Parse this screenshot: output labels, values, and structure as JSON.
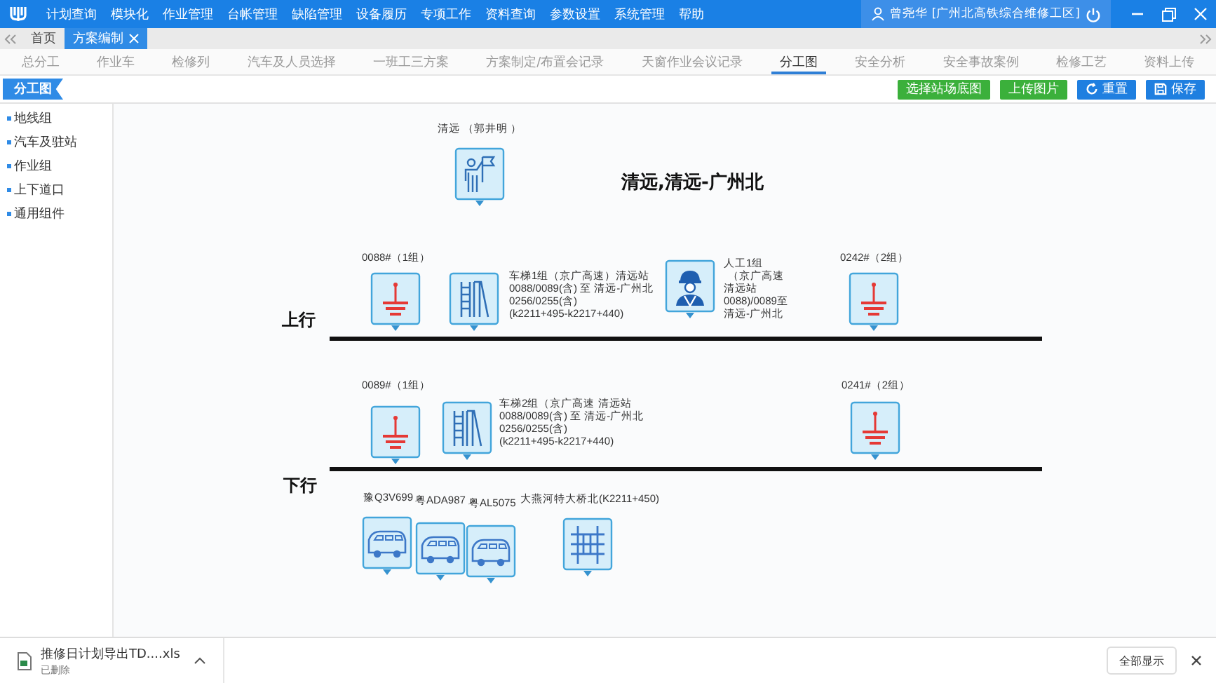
{
  "menu": [
    "计划查询",
    "模块化",
    "作业管理",
    "台帐管理",
    "缺陷管理",
    "设备履历",
    "专项工作",
    "资料查询",
    "参数设置",
    "系统管理",
    "帮助"
  ],
  "user": "曾尧华 [广州北高铁综合维修工区]",
  "window_tabs": [
    {
      "label": "首页",
      "selected": false,
      "closable": false
    },
    {
      "label": "方案编制",
      "selected": true,
      "closable": true
    }
  ],
  "sub_tabs": [
    {
      "label": "总分工",
      "selected": false
    },
    {
      "label": "作业车",
      "selected": false
    },
    {
      "label": "检修列",
      "selected": false
    },
    {
      "label": "汽车及人员选择",
      "selected": false
    },
    {
      "label": "一班工三方案",
      "selected": false
    },
    {
      "label": "方案制定/布置会记录",
      "selected": false
    },
    {
      "label": "天窗作业会议记录",
      "selected": false
    },
    {
      "label": "分工图",
      "selected": true
    },
    {
      "label": "安全分析",
      "selected": false
    },
    {
      "label": "安全事故案例",
      "selected": false
    },
    {
      "label": "检修工艺",
      "selected": false
    },
    {
      "label": "资料上传",
      "selected": false
    }
  ],
  "sidebar": {
    "title": "分工图",
    "items": [
      "地线组",
      "汽车及驻站",
      "作业组",
      "上下道口",
      "通用组件"
    ]
  },
  "toolbar": [
    {
      "label": "选择站场底图",
      "kind": "green"
    },
    {
      "label": "上传图片",
      "kind": "green"
    },
    {
      "label": "重置",
      "kind": "reset"
    },
    {
      "label": "保存",
      "kind": "save"
    }
  ],
  "canvas": {
    "title": "清远,清远-广州北",
    "tracks": [
      {
        "label": "上行"
      },
      {
        "label": "下行"
      }
    ],
    "items": [
      {
        "kind": "flag",
        "label": "清远 （郭井明 ）"
      },
      {
        "kind": "ground",
        "label": "0088#（1组）"
      },
      {
        "kind": "ladder",
        "label": "车梯1组（京广高速）清远站\n0088/0089(含) 至 清远-广州北\n0256/0255(含)\n(k2211+495-k2217+440)"
      },
      {
        "kind": "worker",
        "lines": [
          "人工1组",
          "（京广高速",
          "清远站",
          "0088)/0089至",
          "清远-广州北"
        ]
      },
      {
        "kind": "ground",
        "label": "0242#（2组）"
      },
      {
        "kind": "ground",
        "label": "0089#（1组）"
      },
      {
        "kind": "ladder",
        "label": "车梯2组（京广高速 清远站\n0088/0089(含) 至 清远-广州北\n0256/0255(含)\n(k2211+495-k2217+440)"
      },
      {
        "kind": "ground",
        "label": "0241#（2组）"
      },
      {
        "kind": "van",
        "label": "豫Q3V699"
      },
      {
        "kind": "van",
        "label": "粤ADA987"
      },
      {
        "kind": "van",
        "label": "粤AL5075"
      },
      {
        "kind": "fence",
        "label": "大燕河特大桥北(K2211+450)"
      }
    ]
  },
  "download": {
    "file": "推修日计划导出TD....xls",
    "status": "已删除",
    "show_all": "全部显示"
  }
}
